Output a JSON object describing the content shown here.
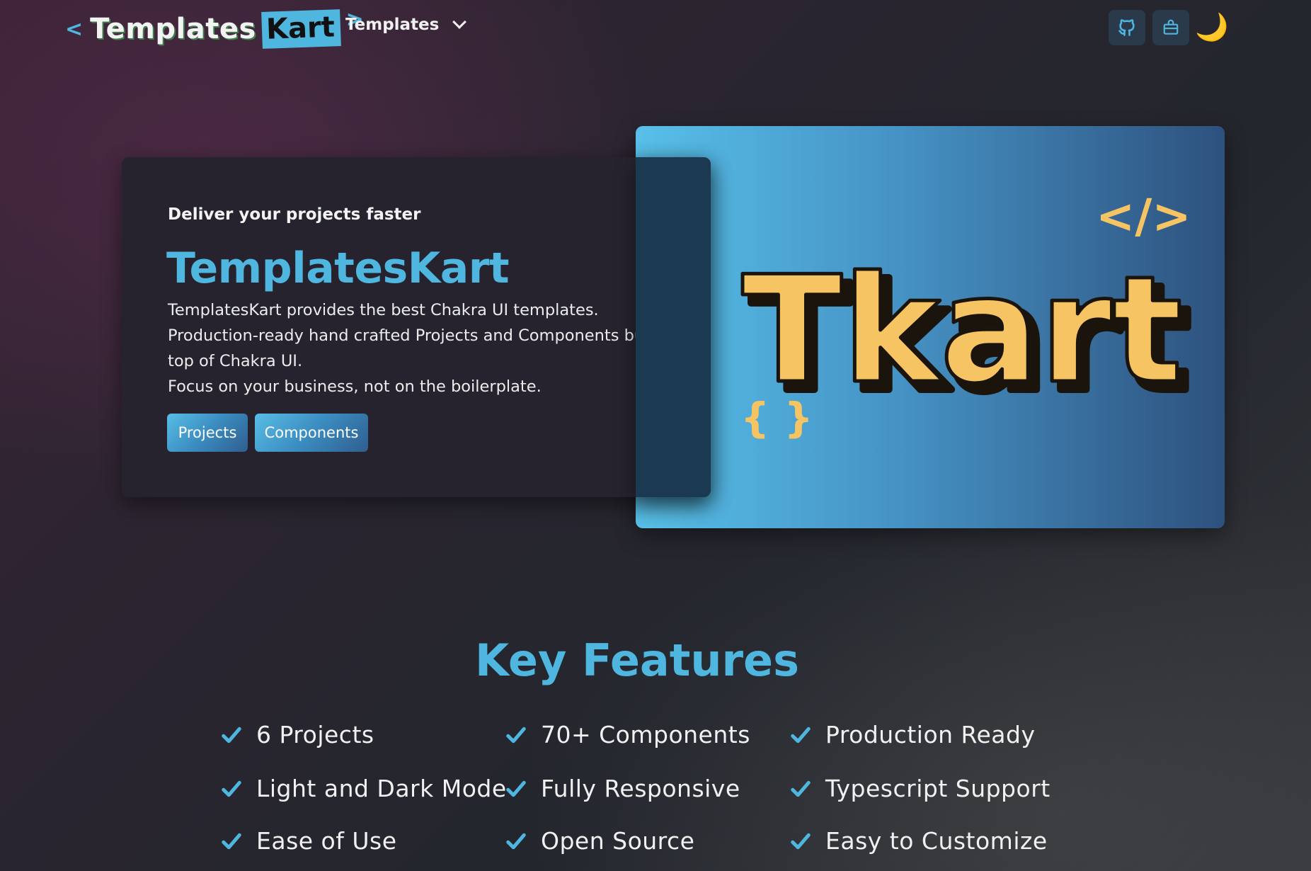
{
  "nav": {
    "logo_word": "Templates",
    "logo_accent": "Kart",
    "logo_left": "<",
    "logo_right": ">",
    "templates_menu_label": "Templates",
    "icons": [
      "github-icon",
      "bag-icon",
      "moon-icon"
    ],
    "moon_glyph": "🌙"
  },
  "hero": {
    "tagline": "Deliver your projects faster",
    "title": "TemplatesKart",
    "description_lines": [
      "TemplatesKart provides the best Chakra UI templates.",
      "Production-ready hand crafted Projects and Components built on",
      "top of Chakra UI.",
      "Focus on your business, not on the boilerplate."
    ],
    "buttons": {
      "projects": "Projects",
      "components": "Components"
    },
    "banner": {
      "wordmark": "Tkart",
      "code_tag": "</>",
      "braces": "{ }"
    }
  },
  "features": {
    "title": "Key Features",
    "items": [
      "6 Projects",
      "70+ Components",
      "Production Ready",
      "Light and Dark Mode",
      "Fully Responsive",
      "Typescript Support",
      "Ease of Use",
      "Open Source",
      "Easy to Customize"
    ]
  },
  "colors": {
    "accent": "#4fb6e0",
    "banner_wordmark": "#f6c462",
    "card_bg": "#26232f"
  }
}
